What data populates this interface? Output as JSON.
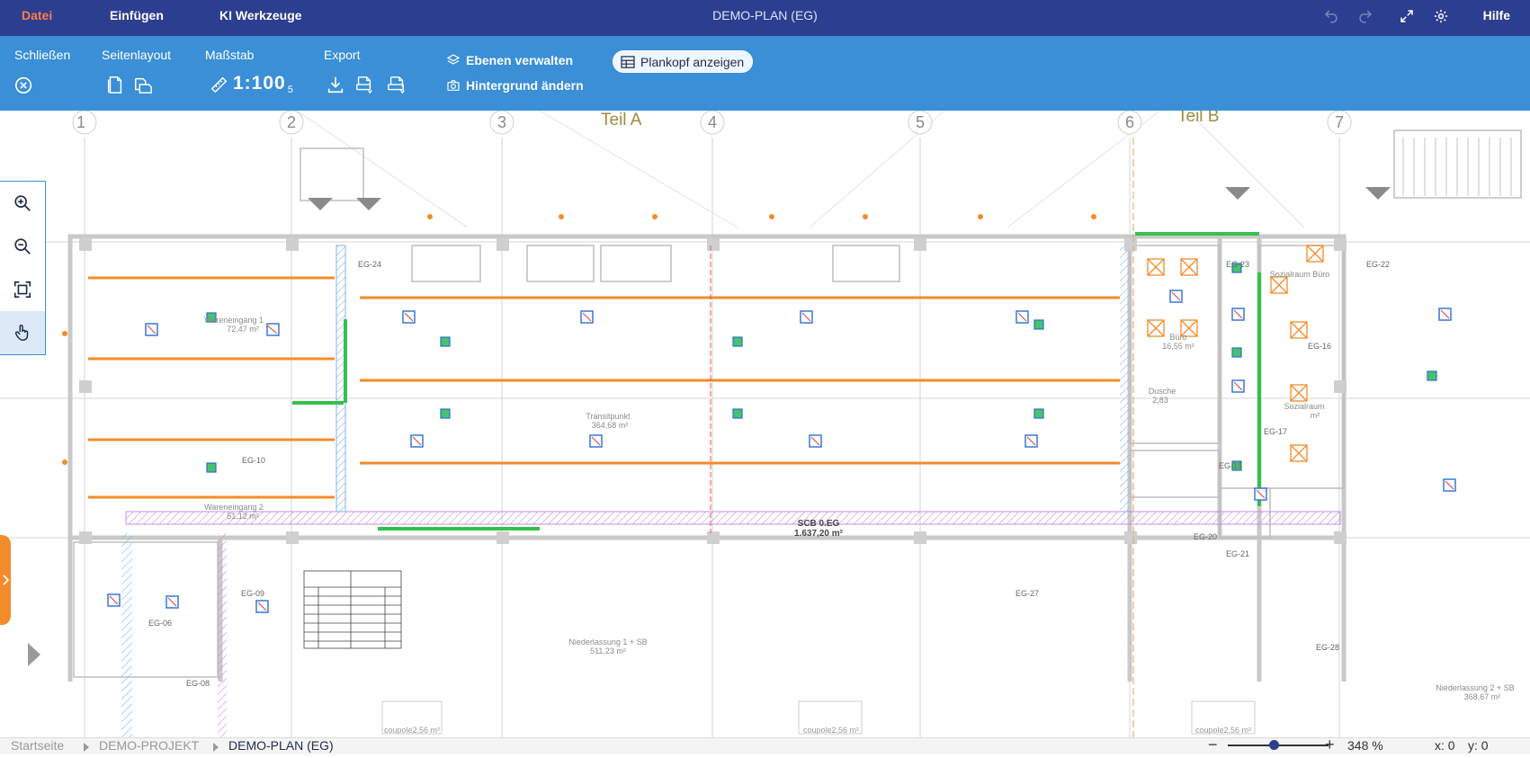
{
  "menubar": {
    "items": [
      "Datei",
      "Einfügen",
      "KI Werkzeuge"
    ],
    "title": "DEMO-PLAN (EG)",
    "help": "Hilfe"
  },
  "ribbon": {
    "close_label": "Schließen",
    "layout_label": "Seitenlayout",
    "scale_label": "Maßstab",
    "scale_value": "1:100",
    "scale_sub": "5",
    "export_label": "Export",
    "layers_label": "Ebenen verwalten",
    "background_label": "Hintergrund ändern",
    "titleblock_label": "Plankopf anzeigen"
  },
  "plan": {
    "sections": [
      "Teil A",
      "Teil B"
    ],
    "axes": [
      "1",
      "2",
      "3",
      "4",
      "5",
      "6",
      "7"
    ],
    "rooms": [
      {
        "name": "Wareneingang 1",
        "area": "72,47 m²"
      },
      {
        "name": "Wareneingang 2",
        "area": "51,12 m²"
      },
      {
        "name": "Transitpunkt",
        "area": "364,68 m²"
      },
      {
        "name": "SCB 0.EG",
        "area": "1.637,20 m²"
      },
      {
        "name": "Niederlassung 1 + SB",
        "area": "511,23 m²"
      },
      {
        "name": "Niederlassung 2 + SB",
        "area": "368,67 m²"
      },
      {
        "name": "Büro",
        "area": "16,55 m²"
      },
      {
        "name": "Dusche",
        "area": "2,83"
      },
      {
        "name": "Sozialraum",
        "area": "m²"
      },
      {
        "name": "Sozialraum Büro",
        "area": ""
      }
    ],
    "room_codes": [
      "EG-10",
      "EG-23",
      "EG-24",
      "EG-22",
      "EG-16",
      "EG-17",
      "EG-19",
      "EG-20",
      "EG-21",
      "EG-27",
      "EG-09",
      "EG-06",
      "EG-08",
      "EG-28"
    ],
    "coupoles": [
      "coupole2,56 m²",
      "coupole2,56 m²",
      "coupole2,56 m²"
    ]
  },
  "statusbar": {
    "breadcrumbs": [
      "Startseite",
      "DEMO-PROJEKT",
      "DEMO-PLAN (EG)"
    ],
    "zoom_minus": "−",
    "zoom_plus": "+",
    "zoom_percent": 348,
    "zoom": "348 %",
    "x": "x: 0",
    "y": "y: 0"
  },
  "colors": {
    "menubar": "#2c3e8f",
    "ribbon": "#3a8fd6",
    "accent": "#ff7e47",
    "plan_orange": "#f28c2a",
    "plan_blue": "#2b6fd4",
    "plan_green": "#33c24b",
    "plan_red": "#e33a3a",
    "plan_purple": "#b56be0"
  },
  "icons": {
    "close": "close-circle-icon",
    "page_layout": "document-icon",
    "scale": "ruler-icon",
    "export": "download-icon",
    "layers": "layers-icon",
    "background": "camera-icon",
    "titleblock": "table-icon",
    "undo": "undo-icon",
    "redo": "redo-icon",
    "fullscreen": "expand-icon",
    "settings": "gear-icon"
  }
}
